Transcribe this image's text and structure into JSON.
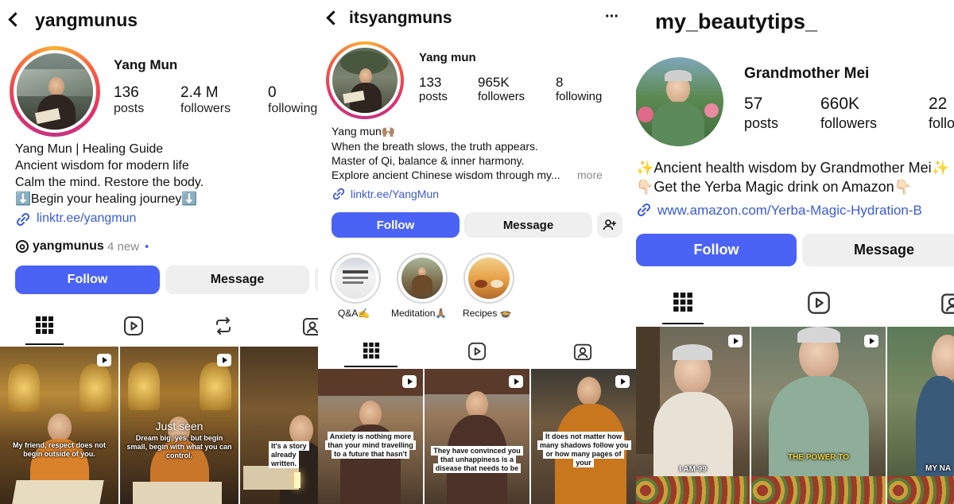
{
  "panels": [
    {
      "header": {
        "username": "yangmunus"
      },
      "profile": {
        "display_name": "Yang Mun"
      },
      "stats": [
        {
          "value": "136",
          "label": "posts"
        },
        {
          "value": "2.4 M",
          "label": "followers"
        },
        {
          "value": "0",
          "label": "following"
        }
      ],
      "bio": [
        "Yang Mun | Healing Guide",
        "Ancient wisdom for modern life",
        "Calm the mind. Restore the body.",
        "⬇️Begin your healing journey⬇️"
      ],
      "link": "linktr.ee/yangmun",
      "threads": {
        "handle": "yangmunus",
        "new_count": "4 new",
        "dot": "•"
      },
      "buttons": {
        "follow": "Follow",
        "message": "Message"
      },
      "grid": [
        {
          "caption": "My friend, respect does not begin outside of you.",
          "style": "outline"
        },
        {
          "caption_title": "Just seen",
          "caption": "Dream big, yes, but begin small, begin with what you can control.",
          "style": "outline"
        },
        {
          "caption": "It's a story already written.",
          "style": "box"
        }
      ]
    },
    {
      "header": {
        "username": "itsyangmuns",
        "more": "···"
      },
      "profile": {
        "display_name": "Yang mun"
      },
      "stats": [
        {
          "value": "133",
          "label": "posts"
        },
        {
          "value": "965K",
          "label": "followers"
        },
        {
          "value": "8",
          "label": "following"
        }
      ],
      "bio": [
        "Yang mun🙌🏽",
        "When the breath slows, the truth appears.",
        "Master of Qi, balance & inner harmony.",
        "Explore ancient Chinese wisdom through my..."
      ],
      "bio_more": "more",
      "link": "linktr.ee/YangMun",
      "buttons": {
        "follow": "Follow",
        "message": "Message"
      },
      "highlights": [
        {
          "label": "Q&A✍️"
        },
        {
          "label": "Meditation🙏🏽"
        },
        {
          "label": "Recipes 🍲"
        }
      ],
      "grid": [
        {
          "caption": "Anxiety is nothing more than your mind travelling to a future that hasn't",
          "style": "box"
        },
        {
          "caption": "They have convinced you that unhappiness is a disease that needs to be",
          "style": "box"
        },
        {
          "caption": "It does not matter how many shadows follow you or how many pages of your",
          "style": "box"
        }
      ]
    },
    {
      "header": {
        "username": "my_beautytips_"
      },
      "profile": {
        "display_name": "Grandmother Mei"
      },
      "stats": [
        {
          "value": "57",
          "label": "posts"
        },
        {
          "value": "660K",
          "label": "followers"
        },
        {
          "value": "22",
          "label": "following"
        }
      ],
      "bio": [
        "✨Ancient health wisdom by Grandmother Mei✨",
        "👇🏻Get the Yerba Magic drink on Amazon👇🏻"
      ],
      "link": "www.amazon.com/Yerba-Magic-Hydration-B",
      "buttons": {
        "follow": "Follow",
        "message": "Message"
      },
      "grid": [
        {
          "caption": "I AM 99",
          "style": "plain"
        },
        {
          "caption": "THE POWER TO",
          "style": "yellow"
        },
        {
          "caption": "MY NA",
          "style": "yellow"
        }
      ]
    }
  ]
}
